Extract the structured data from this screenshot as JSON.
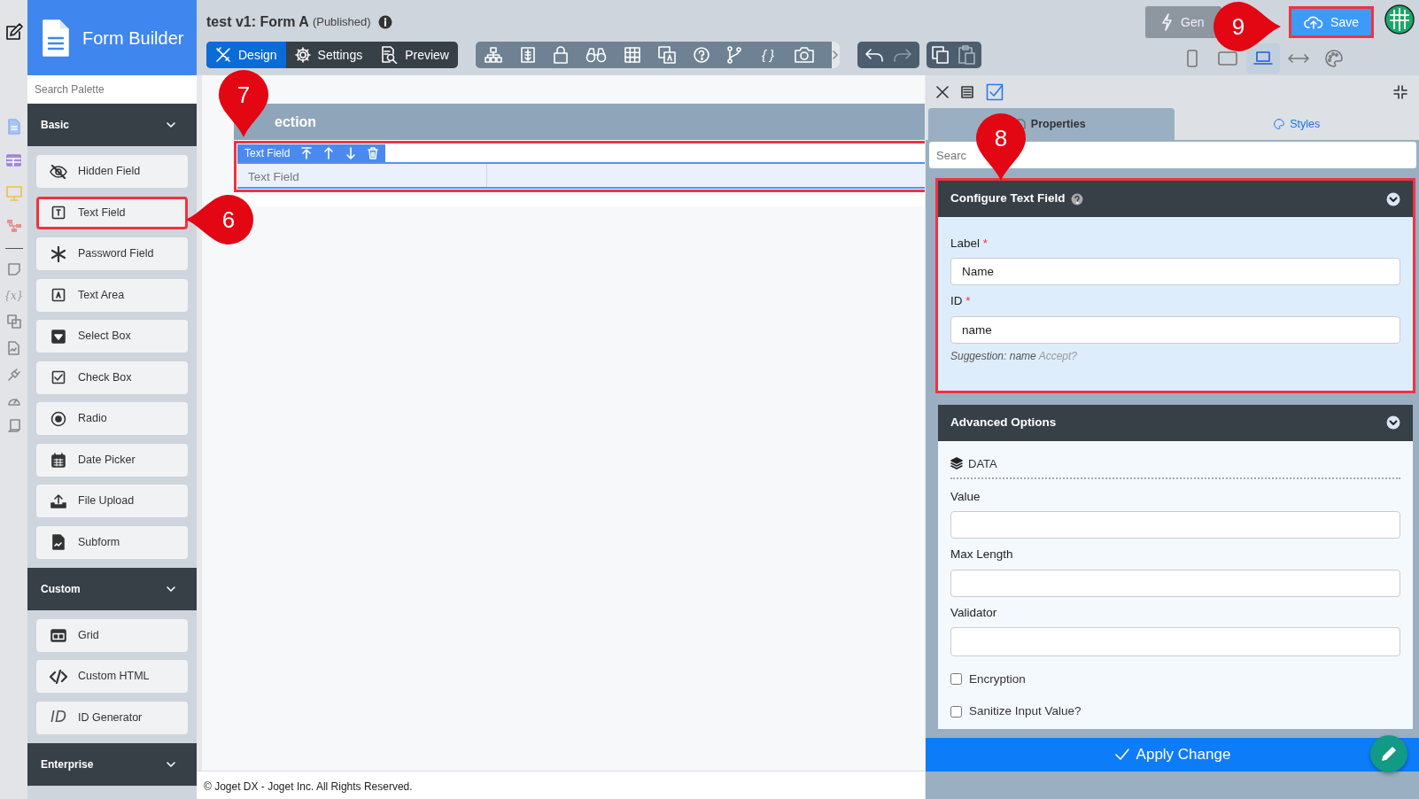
{
  "rail": {
    "variable_label": "{x}"
  },
  "sidebar": {
    "title": "Form Builder",
    "search": {
      "placeholder": "Search Palette"
    },
    "categories": [
      {
        "name": "Basic",
        "items": [
          {
            "label": "Hidden Field",
            "highlighted": false
          },
          {
            "label": "Text Field",
            "highlighted": true
          },
          {
            "label": "Password Field",
            "highlighted": false
          },
          {
            "label": "Text Area",
            "highlighted": false
          },
          {
            "label": "Select Box",
            "highlighted": false
          },
          {
            "label": "Check Box",
            "highlighted": false
          },
          {
            "label": "Radio",
            "highlighted": false
          },
          {
            "label": "Date Picker",
            "highlighted": false
          },
          {
            "label": "File Upload",
            "highlighted": false
          },
          {
            "label": "Subform",
            "highlighted": false
          }
        ]
      },
      {
        "name": "Custom",
        "items": [
          {
            "label": "Grid",
            "highlighted": false
          },
          {
            "label": "Custom HTML",
            "highlighted": false
          },
          {
            "label": "ID Generator",
            "glyph": "ID",
            "highlighted": false
          }
        ]
      },
      {
        "name": "Enterprise"
      }
    ]
  },
  "header": {
    "title": "test v1: Form A",
    "status": "(Published)",
    "modes": [
      {
        "label": "Design",
        "selected": true
      },
      {
        "label": "Settings",
        "selected": false
      },
      {
        "label": "Preview",
        "selected": false
      }
    ],
    "code_label": "{ }",
    "generate_label": "Gen",
    "save": {
      "label": "Save",
      "highlighted": true
    },
    "device_views": [
      {
        "selected": false
      },
      {
        "selected": false
      },
      {
        "selected": true
      },
      {
        "selected": false
      },
      {
        "selected": false
      }
    ]
  },
  "canvas": {
    "section_title": "ection",
    "field": {
      "toolbar_label": "Text Field",
      "label": "Text Field",
      "highlighted": true
    },
    "footer": "© Joget DX - Joget Inc. All Rights Reserved."
  },
  "panel": {
    "tabs": [
      {
        "label": "Properties",
        "selected": true
      },
      {
        "label": "Styles",
        "selected": false
      }
    ],
    "search": {
      "placeholder": "Searc"
    },
    "sections": [
      {
        "title": "Configure Text Field",
        "highlighted": true,
        "fields": [
          {
            "kind": "text",
            "label": "Label",
            "marker": "*",
            "value": "Name"
          },
          {
            "kind": "text",
            "label": "ID",
            "marker": "*",
            "value": "name",
            "hint": "Suggestion: name",
            "action": "Accept?"
          }
        ]
      },
      {
        "title": "Advanced Options",
        "highlighted": false,
        "group": "DATA",
        "fields": [
          {
            "kind": "text",
            "label": "Value"
          },
          {
            "kind": "text",
            "label": "Max Length"
          },
          {
            "kind": "select",
            "label": "Validator"
          },
          {
            "kind": "checkbox",
            "label": "Encryption",
            "checked": false
          },
          {
            "kind": "checkbox",
            "label": "Sanitize Input Value?",
            "checked": false
          }
        ]
      }
    ],
    "apply_label": "Apply Change"
  },
  "callouts": [
    {
      "number": "6"
    },
    {
      "number": "7"
    },
    {
      "number": "8"
    },
    {
      "number": "9"
    }
  ]
}
